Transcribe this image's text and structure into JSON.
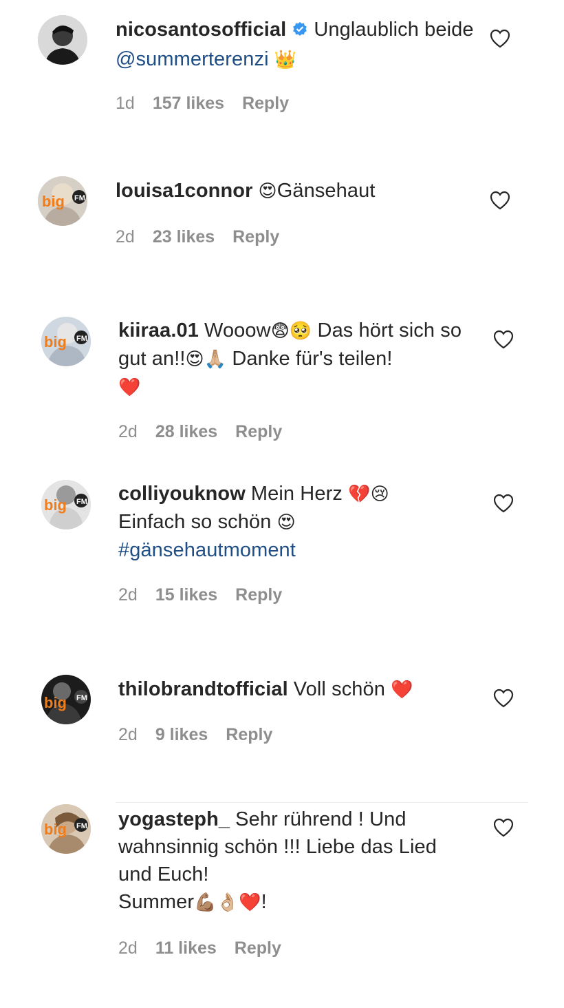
{
  "comments": [
    {
      "username": "nicosantosofficial",
      "verified": true,
      "text_before": "Unglaublich beide ",
      "mention": "@summerterenzi",
      "emoji_after": "👑",
      "time": "1d",
      "likes": "157 likes",
      "reply": "Reply",
      "avatar_style": "dark-portrait"
    },
    {
      "username": "louisa1connor",
      "emoji_before": "😍",
      "text": "Gänsehaut",
      "time": "2d",
      "likes": "23 likes",
      "reply": "Reply",
      "avatar_badge": "bigFM"
    },
    {
      "username": "kiiraa.01",
      "text_a": "Wooow",
      "emoji_a": "😨🥺",
      "text_b": " Das hört sich so gut an!!",
      "emoji_b": "😍🙏🏼",
      "text_c": " Danke für's teilen!",
      "emoji_c": "❤️",
      "time": "2d",
      "likes": "28 likes",
      "reply": "Reply",
      "avatar_badge": "bigFM"
    },
    {
      "username": "colliyouknow",
      "text_a": "Mein Herz ",
      "emoji_a": "💔😢",
      "text_b": "Einfach so schön ",
      "emoji_b": "😍",
      "hashtag": "#gänsehautmoment",
      "time": "2d",
      "likes": "15 likes",
      "reply": "Reply",
      "avatar_badge": "bigFM"
    },
    {
      "username": "thilobrandtofficial",
      "text": "Voll schön ",
      "emoji": "❤️",
      "time": "2d",
      "likes": "9 likes",
      "reply": "Reply",
      "avatar_badge": "bigFM"
    },
    {
      "username": "yogasteph_",
      "text_a": "Sehr rührend ! Und wahnsinnig schön !!! Liebe das Lied und Euch!",
      "text_b": "Summer",
      "emoji_b": "💪🏽👌🏼❤️",
      "text_c": "!",
      "time": "2d",
      "likes": "11 likes",
      "reply": "Reply",
      "avatar_badge": "bigFM"
    }
  ],
  "colors": {
    "text": "#262626",
    "meta": "#8e8e8e",
    "link": "#1f4e86",
    "verified": "#3897f0",
    "badge_orange": "#f07d1a"
  },
  "icons": {
    "like": "heart-outline-icon",
    "verified": "verified-badge-icon"
  }
}
